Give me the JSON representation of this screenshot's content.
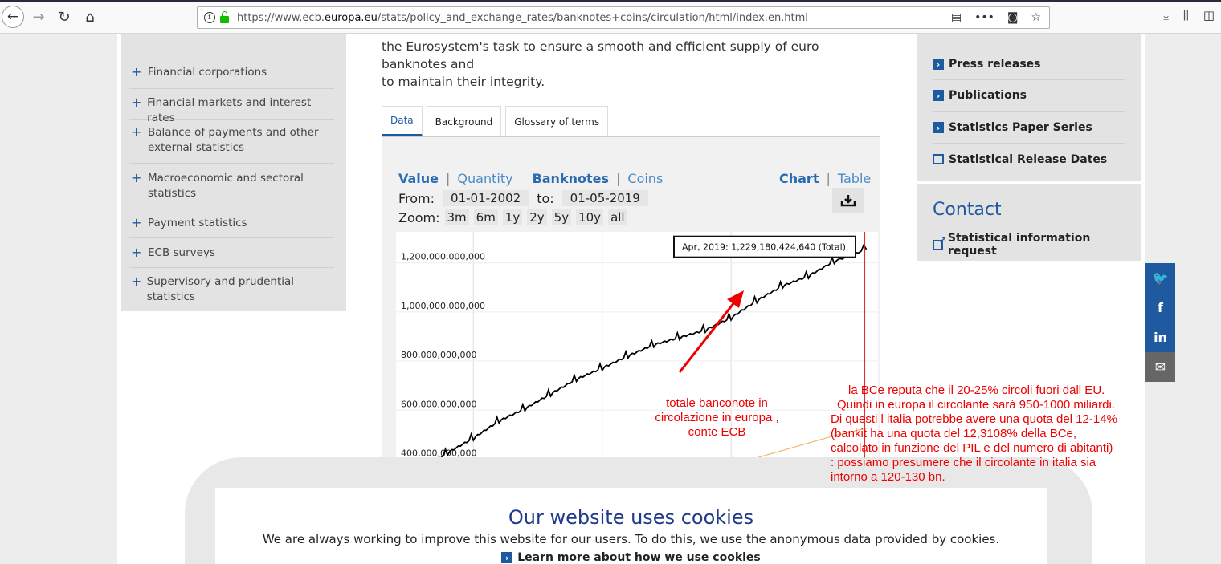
{
  "browser": {
    "url_prefix": "https://www.ecb.",
    "url_domain": "europa.eu",
    "url_path": "/stats/policy_and_exchange_rates/banknotes+coins/circulation/html/index.en.html"
  },
  "left_nav": {
    "items": [
      {
        "label": "Financial corporations"
      },
      {
        "label": "Financial markets and interest rates"
      },
      {
        "label": "Balance of payments and other external statistics"
      },
      {
        "label": "Macroeconomic and sectoral statistics"
      },
      {
        "label": "Payment statistics"
      },
      {
        "label": "ECB surveys"
      },
      {
        "label": "Supervisory and prudential statistics"
      }
    ]
  },
  "intro": {
    "line1": "the Eurosystem's task to ensure a smooth and efficient supply of euro banknotes and",
    "line2": "to maintain their integrity."
  },
  "tabs": [
    {
      "label": "Data"
    },
    {
      "label": "Background"
    },
    {
      "label": "Glossary of terms"
    }
  ],
  "chart_controls": {
    "value": "Value",
    "quantity": "Quantity",
    "banknotes": "Banknotes",
    "coins": "Coins",
    "chart": "Chart",
    "table": "Table",
    "from_label": "From:",
    "from_date": "01-01-2002",
    "to_label": "to:",
    "to_date": "01-05-2019",
    "zoom_label": "Zoom:",
    "zoom_options": [
      "3m",
      "6m",
      "1y",
      "2y",
      "5y",
      "10y",
      "all"
    ]
  },
  "chart_data": {
    "type": "line",
    "ytick_labels": [
      "1,200,000,000,000",
      "1,000,000,000,000",
      "800,000,000,000",
      "600,000,000,000",
      "400,000,000,000"
    ],
    "ytick_values": [
      1200000000000,
      1000000000000,
      800000000000,
      600000000000,
      400000000000
    ],
    "ylim": [
      320000000000,
      1300000000000
    ],
    "series": [
      {
        "name": "Total",
        "color": "#000000",
        "x": [
          2002.0,
          2003.0,
          2004.0,
          2005.0,
          2006.0,
          2007.0,
          2008.0,
          2009.0,
          2010.0,
          2011.0,
          2012.0,
          2013.0,
          2014.0,
          2015.0,
          2016.0,
          2017.0,
          2018.0,
          2019.25
        ],
        "values": [
          330000000000,
          400000000000,
          460000000000,
          530000000000,
          580000000000,
          640000000000,
          700000000000,
          745000000000,
          795000000000,
          840000000000,
          870000000000,
          900000000000,
          950000000000,
          1020000000000,
          1080000000000,
          1120000000000,
          1180000000000,
          1229180424640
        ]
      },
      {
        "color": "#f0b86a",
        "x": [
          2013.0,
          2014.0,
          2015.0,
          2016.0,
          2017.0,
          2018.0,
          2019.25
        ],
        "values": [
          340000000000,
          355000000000,
          380000000000,
          410000000000,
          440000000000,
          470000000000,
          500000000000
        ]
      }
    ],
    "tooltip": "Apr, 2019: 1,229,180,424,640 (Total)"
  },
  "right_nav": {
    "items": [
      {
        "label": "Press releases"
      },
      {
        "label": "Publications"
      },
      {
        "label": "Statistics Paper Series"
      },
      {
        "label": "Statistical Release Dates"
      }
    ],
    "contact_title": "Contact",
    "contact_link": "Statistical information request"
  },
  "social": {
    "twitter": "🐦",
    "facebook": "f",
    "linkedin": "in",
    "mail": "✉"
  },
  "cookie": {
    "title": "Our website uses cookies",
    "text": "We are always working to improve this website for our users. To do this, we use the anonymous data provided by cookies.",
    "link": "Learn more about how we use cookies"
  },
  "annotations": {
    "arrow_note": [
      "totale banconote in",
      "circolazione in europa ,",
      "conte ECB"
    ],
    "right_note": [
      "la BCe reputa che il 20-25% circoli fuori dall EU.",
      "Quindi in europa il circolante sarà 950-1000 miliardi.",
      "Di questi l italia potrebbe avere una quota del 12-14%",
      "(bankit ha una quota del 12,3108% della BCe,",
      "calcolato in funzione del PIL e del numero di abitanti)",
      ": possiamo presumere che il circolante in italia sia",
      "intorno a 120-130 bn."
    ]
  }
}
